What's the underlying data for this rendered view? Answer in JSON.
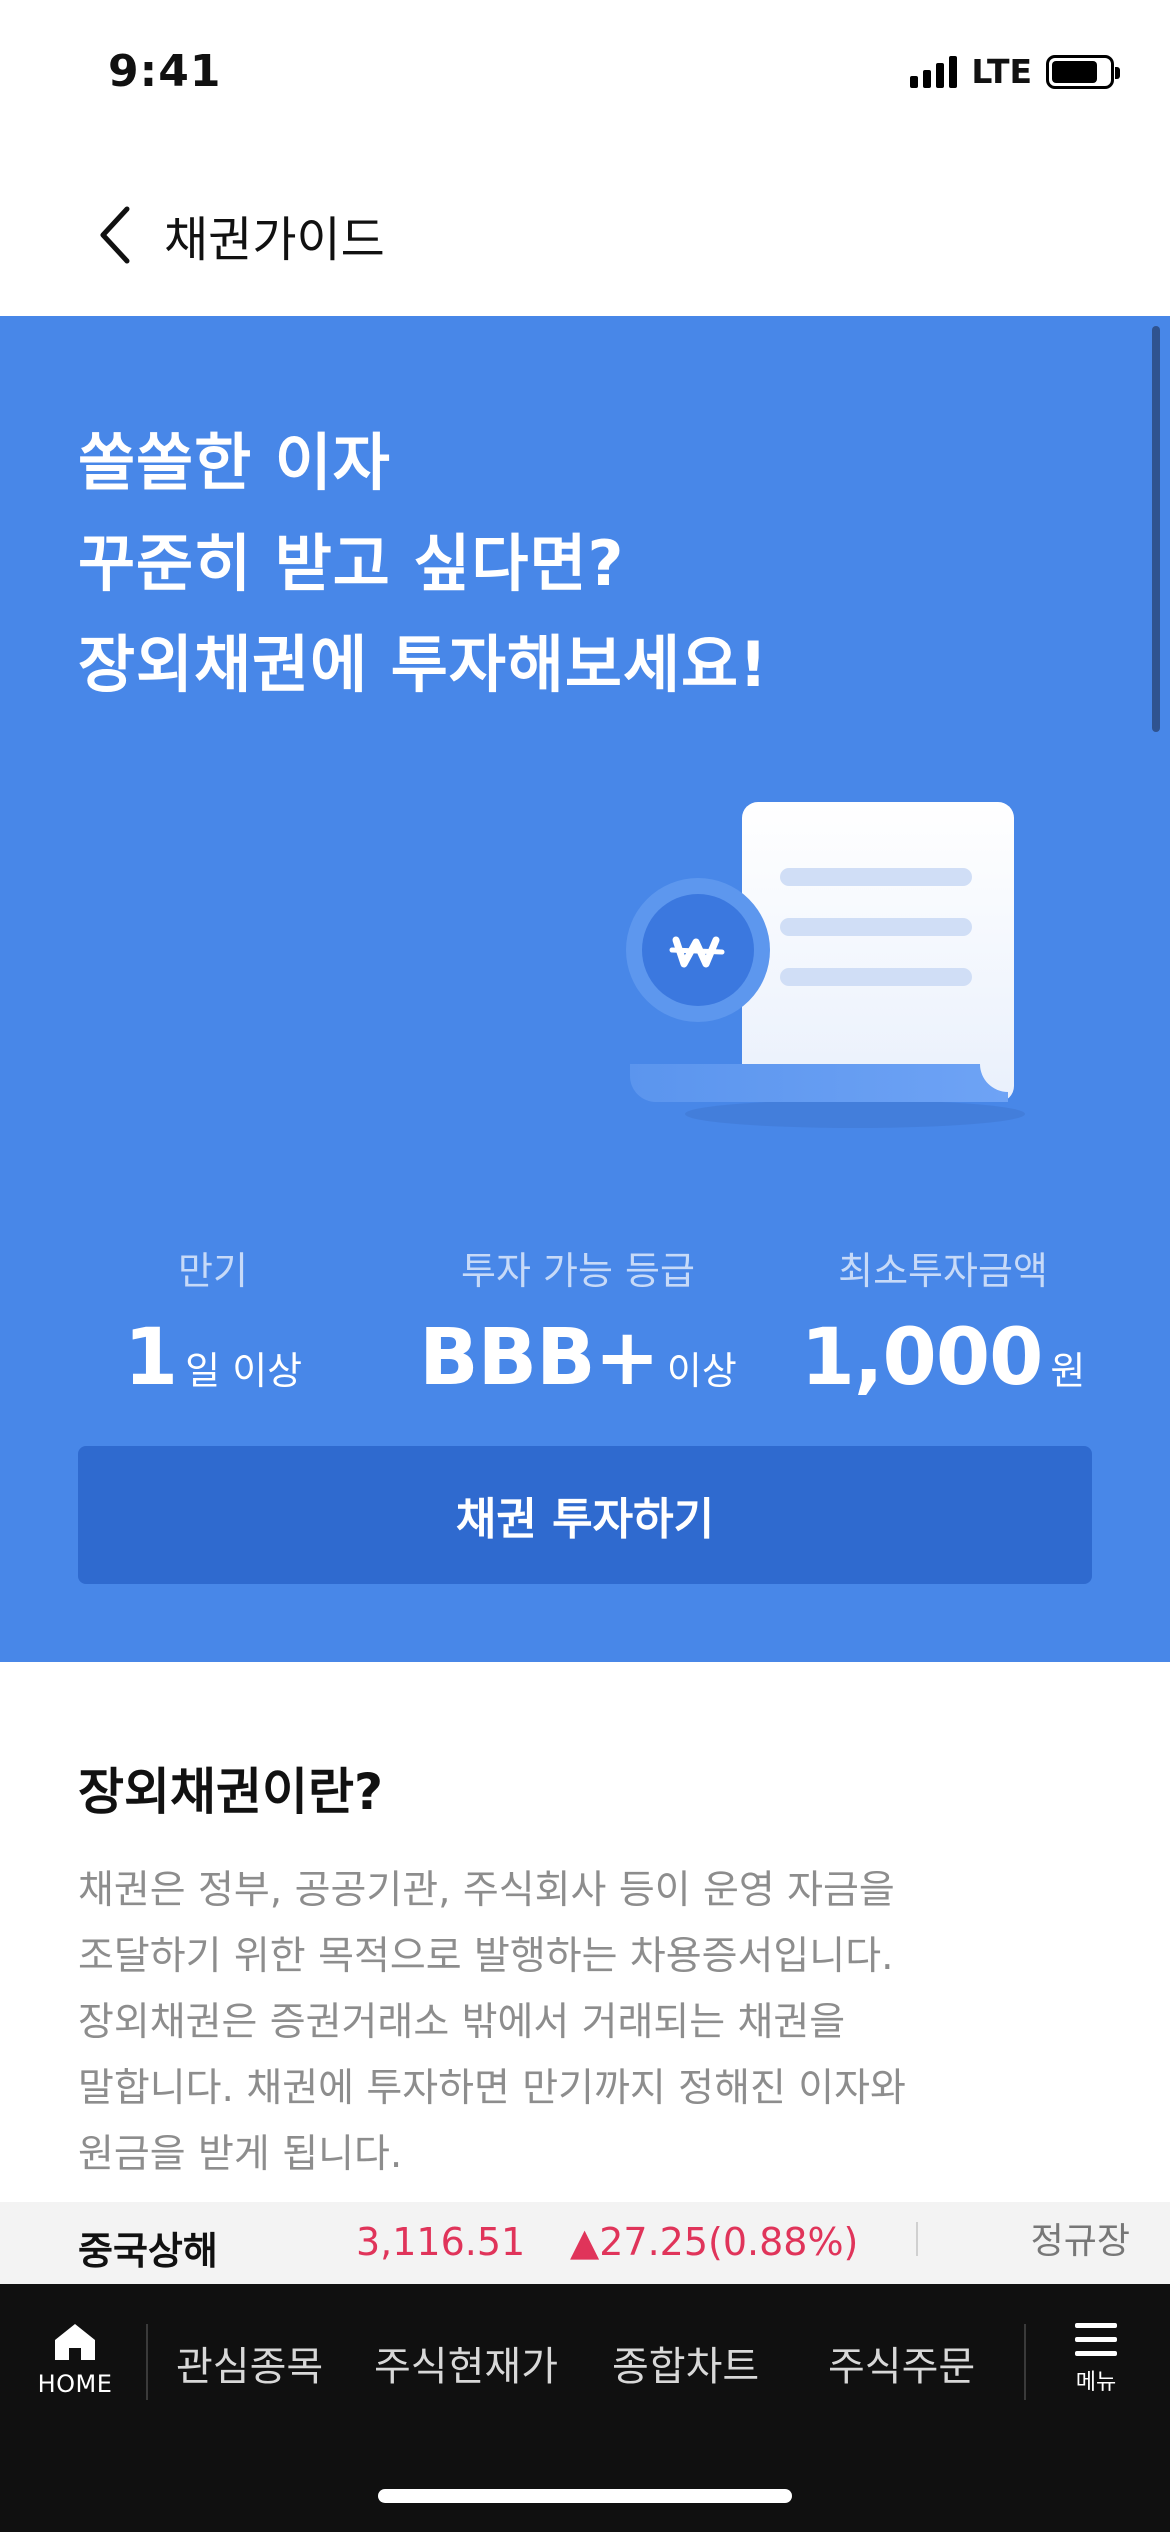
{
  "status_bar": {
    "time": "9:41",
    "network": "LTE",
    "battery_percent": 80
  },
  "header": {
    "title": "채권가이드",
    "back_icon": "chevron-left-icon"
  },
  "hero": {
    "lines": [
      "쏠쏠한 이자",
      "꾸준히 받고 싶다면?",
      "장외채권에 투자해보세요!"
    ],
    "background": "#4887e8",
    "illustration": {
      "coin_icon": "won-coin-icon",
      "document_icon": "bond-document-icon"
    },
    "stats": [
      {
        "label": "만기",
        "value": "1",
        "unit": "일 이상"
      },
      {
        "label": "투자 가능 등급",
        "value": "BBB+",
        "unit": "이상"
      },
      {
        "label": "최소투자금액",
        "value": "1,000",
        "unit": "원"
      }
    ],
    "invest_button": {
      "label": "채권 투자하기",
      "color": "#2f6acf"
    }
  },
  "section": {
    "title": "장외채권이란?",
    "body": [
      "채권은 정부, 공공기관, 주식회사 등이 운영 자금을",
      "조달하기 위한 목적으로 발행하는 차용증서입니다.",
      "장외채권은 증권거래소 밖에서 거래되는 채권을",
      "말합니다. 채권에 투자하면 만기까지 정해진 이자와",
      "원금을 받게 됩니다."
    ]
  },
  "ticker": {
    "name": "중국상해",
    "price": "3,116.51",
    "change": "▲27.25(0.88%)",
    "session": "정규장",
    "up_color": "#e0345a"
  },
  "bottom_nav": {
    "home_label": "HOME",
    "items": [
      "관심종목",
      "주식현재가",
      "종합차트",
      "주식주문"
    ],
    "menu_label": "메뉴"
  }
}
